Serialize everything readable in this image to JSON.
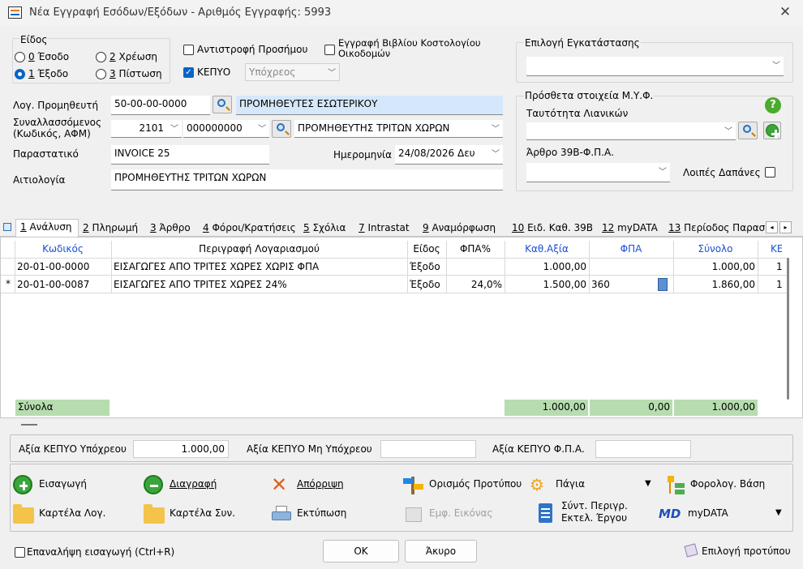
{
  "window": {
    "title": "Νέα Εγγραφή Εσόδων/Εξόδων - Αριθμός Εγγραφής: 5993"
  },
  "eidos": {
    "label": "Είδος",
    "options": [
      {
        "key": "0",
        "rest": " Έσοδο"
      },
      {
        "key": "2",
        "rest": " Χρέωση"
      },
      {
        "key": "1",
        "rest": " Έξοδο"
      },
      {
        "key": "3",
        "rest": " Πίστωση"
      }
    ]
  },
  "antistrofi": {
    "label": "Αντιστροφή Προσήμου"
  },
  "kostologio": {
    "label_1": "Εγγραφή Βιβλίου Κοστολογίου",
    "label_2": "Οικοδομών"
  },
  "kepyo": {
    "label": "ΚΕΠΥΟ",
    "check_mark": "✓",
    "select_value": "Υπόχρεος"
  },
  "egkatastasi": {
    "label": "Επιλογή Εγκατάστασης",
    "value": ""
  },
  "myf": {
    "label": "Πρόσθετα στοιχεία Μ.Υ.Φ.",
    "help": "?",
    "tautotita_label": "Ταυτότητα Λιανικών",
    "tautotita_value": "",
    "arthro_label": "Άρθρο 39Β-Φ.Π.Α.",
    "arthro_value": "",
    "loipes_label": "Λοιπές Δαπάνες"
  },
  "log_promitheuti": {
    "label": "Λογ. Προμηθευτή",
    "code": "50-00-00-0000",
    "name": "ΠΡΟΜΗΘΕΥΤΕΣ ΕΣΩΤΕΡΙΚΟΥ"
  },
  "synallassomenos": {
    "label_1": "Συναλλασσόμενος",
    "label_2": "(Κωδικός, ΑΦΜ)",
    "code": "2101",
    "afm": "000000000",
    "name": "ΠΡΟΜΗΘΕΥΤΗΣ ΤΡΙΤΩΝ ΧΩΡΩΝ"
  },
  "parastatiko": {
    "label": "Παραστατικό",
    "value": "INVOICE 25"
  },
  "imerominia": {
    "label": "Ημερομηνία",
    "value": "24/08/2026 Δευ"
  },
  "aitiologia": {
    "label": "Αιτιολογία",
    "value": "ΠΡΟΜΗΘΕΥΤΗΣ ΤΡΙΤΩΝ ΧΩΡΩΝ"
  },
  "tabs": [
    {
      "key": "1",
      "rest": " Ανάλυση"
    },
    {
      "key": "2",
      "rest": " Πληρωμή"
    },
    {
      "key": "3",
      "rest": " Άρθρο"
    },
    {
      "key": "4",
      "rest": " Φόροι/Κρατήσεις"
    },
    {
      "key": "5",
      "rest": " Σχόλια"
    },
    {
      "key": "7",
      "rest": " Intrastat"
    },
    {
      "key": "9",
      "rest": " Αναμόρφωση"
    },
    {
      "key": "10",
      "rest": " Ειδ. Καθ. 39Β"
    },
    {
      "key": "12",
      "rest": " myDATA"
    },
    {
      "key": "13",
      "rest": " Περίοδος Παραστ"
    }
  ],
  "grid": {
    "headers": [
      "Κωδικός",
      "Περιγραφή Λογαριασμού",
      "Είδος",
      "ΦΠΑ%",
      "Καθ.Αξία",
      "ΦΠΑ",
      "Σύνολο",
      "ΚΕ"
    ],
    "rows": [
      {
        "marker": "",
        "code": "20-01-00-0000",
        "desc": "ΕΙΣΑΓΩΓΕΣ ΑΠΟ ΤΡΙΤΕΣ ΧΩΡΕΣ ΧΩΡΙΣ ΦΠΑ",
        "eidos": "Έξοδο",
        "fpa_pct": "",
        "kath": "1.000,00",
        "fpa": "",
        "total": "1.000,00",
        "ke": "1"
      },
      {
        "marker": "*",
        "code": "20-01-00-0087",
        "desc": "ΕΙΣΑΓΩΓΕΣ ΑΠΟ ΤΡΙΤΕΣ ΧΩΡΕΣ 24%",
        "eidos": "Έξοδο",
        "fpa_pct": "24,0%",
        "kath": "1.500,00",
        "fpa": "360",
        "total": "1.860,00",
        "ke": "1"
      }
    ],
    "totals": {
      "label": "Σύνολα",
      "kath": "1.000,00",
      "fpa": "0,00",
      "total": "1.000,00"
    }
  },
  "kepyo_values": {
    "ypoxreou_label": "Αξία ΚΕΠΥΟ Υπόχρεου",
    "ypoxreou_value": "1.000,00",
    "mi_ypoxreou_label": "Αξία ΚΕΠΥΟ Μη Υπόχρεου",
    "mi_ypoxreou_value": "",
    "fpa_label": "Αξία ΚΕΠΥΟ Φ.Π.Α.",
    "fpa_value": ""
  },
  "actions": {
    "eisagogi": "Εισαγωγή",
    "diagrafi": "Διαγραφή",
    "aporripsi": "Απόρριψη",
    "orismos": "Ορισμός Προτύπου",
    "pagia": "Πάγια",
    "forologiki": "Φορολογ. Βάση",
    "kartela_log": "Καρτέλα Λογ.",
    "kartela_syn": "Καρτέλα Συν.",
    "ektyposi": "Εκτύπωση",
    "emf_eikonas": "Εμφ. Εικόνας",
    "syntomi_1": "Σύντ. Περιγρ.",
    "syntomi_2": "Εκτελ. Έργου",
    "mydata": "myDATA",
    "mydata_logo": "MD"
  },
  "footer": {
    "repeat_label": "Επαναλήψη εισαγωγή (Ctrl+R)",
    "ok": "OK",
    "cancel": "Άκυρο",
    "template": "Επιλογή προτύπου"
  },
  "colors": {
    "accent": "#0a64c8",
    "totals_bg": "#b7dcb0",
    "header_blue": "#1a4fd6"
  }
}
